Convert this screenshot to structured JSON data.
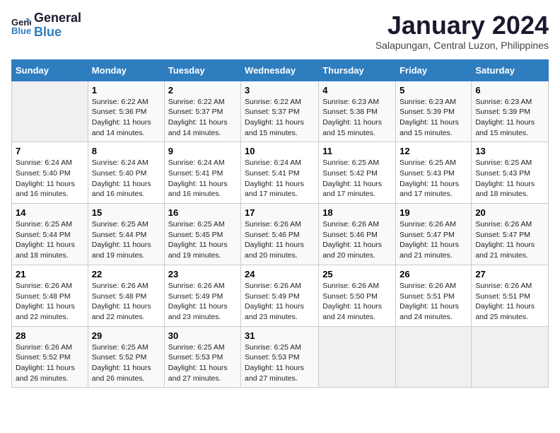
{
  "header": {
    "logo_line1": "General",
    "logo_line2": "Blue",
    "month": "January 2024",
    "location": "Salapungan, Central Luzon, Philippines"
  },
  "weekdays": [
    "Sunday",
    "Monday",
    "Tuesday",
    "Wednesday",
    "Thursday",
    "Friday",
    "Saturday"
  ],
  "weeks": [
    [
      {
        "day": "",
        "info": ""
      },
      {
        "day": "1",
        "info": "Sunrise: 6:22 AM\nSunset: 5:36 PM\nDaylight: 11 hours\nand 14 minutes."
      },
      {
        "day": "2",
        "info": "Sunrise: 6:22 AM\nSunset: 5:37 PM\nDaylight: 11 hours\nand 14 minutes."
      },
      {
        "day": "3",
        "info": "Sunrise: 6:22 AM\nSunset: 5:37 PM\nDaylight: 11 hours\nand 15 minutes."
      },
      {
        "day": "4",
        "info": "Sunrise: 6:23 AM\nSunset: 5:38 PM\nDaylight: 11 hours\nand 15 minutes."
      },
      {
        "day": "5",
        "info": "Sunrise: 6:23 AM\nSunset: 5:39 PM\nDaylight: 11 hours\nand 15 minutes."
      },
      {
        "day": "6",
        "info": "Sunrise: 6:23 AM\nSunset: 5:39 PM\nDaylight: 11 hours\nand 15 minutes."
      }
    ],
    [
      {
        "day": "7",
        "info": "Sunrise: 6:24 AM\nSunset: 5:40 PM\nDaylight: 11 hours\nand 16 minutes."
      },
      {
        "day": "8",
        "info": "Sunrise: 6:24 AM\nSunset: 5:40 PM\nDaylight: 11 hours\nand 16 minutes."
      },
      {
        "day": "9",
        "info": "Sunrise: 6:24 AM\nSunset: 5:41 PM\nDaylight: 11 hours\nand 16 minutes."
      },
      {
        "day": "10",
        "info": "Sunrise: 6:24 AM\nSunset: 5:41 PM\nDaylight: 11 hours\nand 17 minutes."
      },
      {
        "day": "11",
        "info": "Sunrise: 6:25 AM\nSunset: 5:42 PM\nDaylight: 11 hours\nand 17 minutes."
      },
      {
        "day": "12",
        "info": "Sunrise: 6:25 AM\nSunset: 5:43 PM\nDaylight: 11 hours\nand 17 minutes."
      },
      {
        "day": "13",
        "info": "Sunrise: 6:25 AM\nSunset: 5:43 PM\nDaylight: 11 hours\nand 18 minutes."
      }
    ],
    [
      {
        "day": "14",
        "info": "Sunrise: 6:25 AM\nSunset: 5:44 PM\nDaylight: 11 hours\nand 18 minutes."
      },
      {
        "day": "15",
        "info": "Sunrise: 6:25 AM\nSunset: 5:44 PM\nDaylight: 11 hours\nand 19 minutes."
      },
      {
        "day": "16",
        "info": "Sunrise: 6:25 AM\nSunset: 5:45 PM\nDaylight: 11 hours\nand 19 minutes."
      },
      {
        "day": "17",
        "info": "Sunrise: 6:26 AM\nSunset: 5:46 PM\nDaylight: 11 hours\nand 20 minutes."
      },
      {
        "day": "18",
        "info": "Sunrise: 6:26 AM\nSunset: 5:46 PM\nDaylight: 11 hours\nand 20 minutes."
      },
      {
        "day": "19",
        "info": "Sunrise: 6:26 AM\nSunset: 5:47 PM\nDaylight: 11 hours\nand 21 minutes."
      },
      {
        "day": "20",
        "info": "Sunrise: 6:26 AM\nSunset: 5:47 PM\nDaylight: 11 hours\nand 21 minutes."
      }
    ],
    [
      {
        "day": "21",
        "info": "Sunrise: 6:26 AM\nSunset: 5:48 PM\nDaylight: 11 hours\nand 22 minutes."
      },
      {
        "day": "22",
        "info": "Sunrise: 6:26 AM\nSunset: 5:48 PM\nDaylight: 11 hours\nand 22 minutes."
      },
      {
        "day": "23",
        "info": "Sunrise: 6:26 AM\nSunset: 5:49 PM\nDaylight: 11 hours\nand 23 minutes."
      },
      {
        "day": "24",
        "info": "Sunrise: 6:26 AM\nSunset: 5:49 PM\nDaylight: 11 hours\nand 23 minutes."
      },
      {
        "day": "25",
        "info": "Sunrise: 6:26 AM\nSunset: 5:50 PM\nDaylight: 11 hours\nand 24 minutes."
      },
      {
        "day": "26",
        "info": "Sunrise: 6:26 AM\nSunset: 5:51 PM\nDaylight: 11 hours\nand 24 minutes."
      },
      {
        "day": "27",
        "info": "Sunrise: 6:26 AM\nSunset: 5:51 PM\nDaylight: 11 hours\nand 25 minutes."
      }
    ],
    [
      {
        "day": "28",
        "info": "Sunrise: 6:26 AM\nSunset: 5:52 PM\nDaylight: 11 hours\nand 26 minutes."
      },
      {
        "day": "29",
        "info": "Sunrise: 6:25 AM\nSunset: 5:52 PM\nDaylight: 11 hours\nand 26 minutes."
      },
      {
        "day": "30",
        "info": "Sunrise: 6:25 AM\nSunset: 5:53 PM\nDaylight: 11 hours\nand 27 minutes."
      },
      {
        "day": "31",
        "info": "Sunrise: 6:25 AM\nSunset: 5:53 PM\nDaylight: 11 hours\nand 27 minutes."
      },
      {
        "day": "",
        "info": ""
      },
      {
        "day": "",
        "info": ""
      },
      {
        "day": "",
        "info": ""
      }
    ]
  ]
}
